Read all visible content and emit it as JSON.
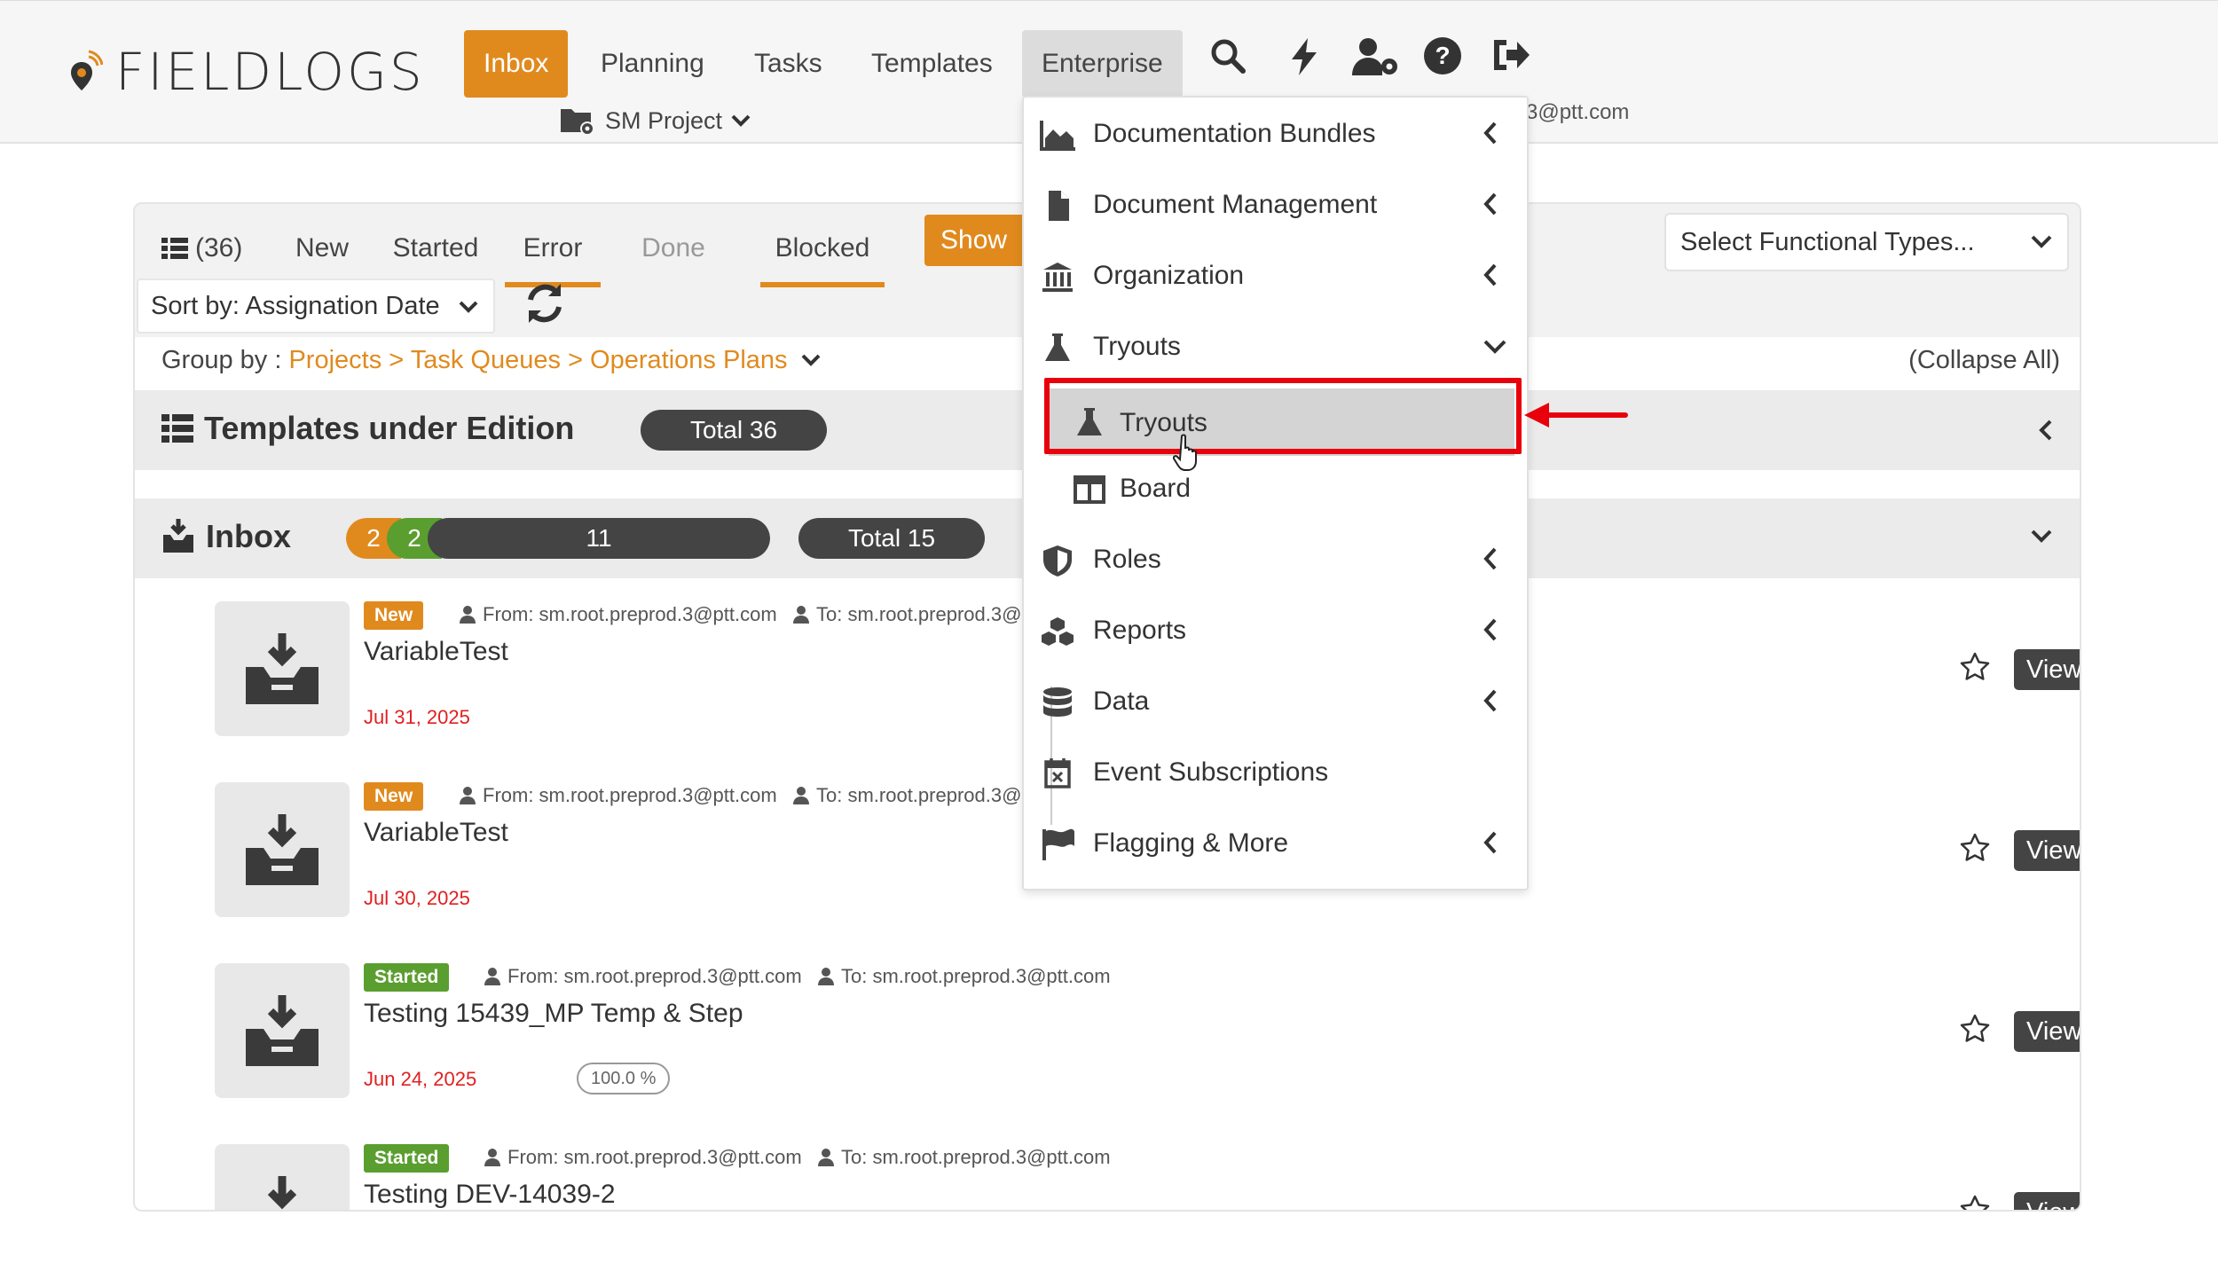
{
  "brand": {
    "name": "FIELDLOGS",
    "accent": "#e08a1e"
  },
  "nav": {
    "items": [
      {
        "label": "Inbox",
        "active": true
      },
      {
        "label": "Planning"
      },
      {
        "label": "Tasks"
      },
      {
        "label": "Templates"
      },
      {
        "label": "Enterprise",
        "hover": true
      }
    ],
    "icons": [
      "search-icon",
      "bolt-icon",
      "user-settings-icon",
      "help-icon",
      "logout-icon"
    ],
    "project": "SM Project",
    "user_email_partial": "3@ptt.com"
  },
  "tabs": {
    "count": "(36)",
    "items": [
      "New",
      "Started",
      "Error",
      "Done",
      "Blocked"
    ],
    "show_button": "Show E",
    "functional_types_placeholder": "Select Functional Types..."
  },
  "sort": {
    "label": "Sort by: Assignation Date"
  },
  "groupby": {
    "label": "Group by :",
    "path": "Projects > Task Queues > Operations Plans",
    "collapse_all": "(Collapse All)"
  },
  "templates_section": {
    "title": "Templates under Edition",
    "total": "Total 36"
  },
  "inbox_section": {
    "title": "Inbox",
    "progress": {
      "segments": [
        {
          "value": "2",
          "color": "#e08a1e"
        },
        {
          "value": "2",
          "color": "#5a9e2f"
        },
        {
          "value": "11",
          "color": "#444444"
        }
      ]
    },
    "total": "Total 15"
  },
  "items": [
    {
      "status": "New",
      "from": "From: sm.root.preprod.3@ptt.com",
      "to": "To: sm.root.preprod.3@",
      "title": "VariableTest",
      "date": "Jul 31, 2025",
      "view": "View"
    },
    {
      "status": "New",
      "from": "From: sm.root.preprod.3@ptt.com",
      "to": "To: sm.root.preprod.3@",
      "title": "VariableTest",
      "date": "Jul 30, 2025",
      "view": "View"
    },
    {
      "status": "Started",
      "from": "From: sm.root.preprod.3@ptt.com",
      "to": "To: sm.root.preprod.3@ptt.com",
      "title": "Testing 15439_MP Temp & Step",
      "date": "Jun 24, 2025",
      "progress": "100.0 %",
      "view": "View"
    },
    {
      "status": "Started",
      "from": "From: sm.root.preprod.3@ptt.com",
      "to": "To: sm.root.preprod.3@ptt.com",
      "title": "Testing DEV-14039-2",
      "view": "View"
    }
  ],
  "enterprise_menu": {
    "items": [
      {
        "label": "Documentation Bundles",
        "icon": "area-chart-icon",
        "chevron": "left"
      },
      {
        "label": "Document Management",
        "icon": "file-icon",
        "chevron": "left"
      },
      {
        "label": "Organization",
        "icon": "bank-icon",
        "chevron": "left"
      },
      {
        "label": "Tryouts",
        "icon": "flask-icon",
        "chevron": "down"
      },
      {
        "label": "Tryouts",
        "icon": "flask-icon",
        "sub": true,
        "highlighted": true
      },
      {
        "label": "Board",
        "icon": "board-icon",
        "sub": true
      },
      {
        "label": "Roles",
        "icon": "shield-icon",
        "chevron": "left"
      },
      {
        "label": "Reports",
        "icon": "cubes-icon",
        "chevron": "left"
      },
      {
        "label": "Data",
        "icon": "database-icon",
        "chevron": "left"
      },
      {
        "label": "Event Subscriptions",
        "icon": "calendar-x-icon"
      },
      {
        "label": "Flagging & More",
        "icon": "flag-icon",
        "chevron": "left"
      }
    ]
  },
  "annotation": {
    "color": "#e8000c"
  }
}
